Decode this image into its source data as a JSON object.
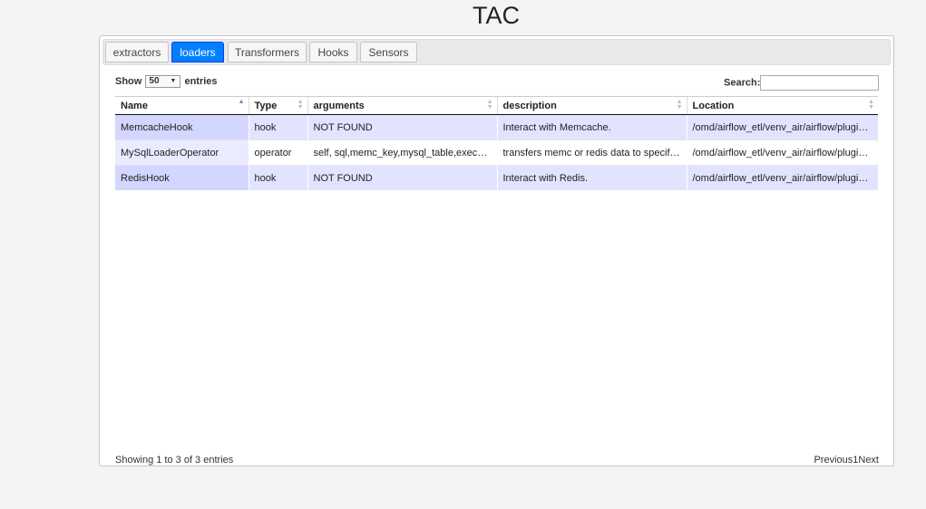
{
  "title": "TAC",
  "tabs": [
    {
      "label": "extractors"
    },
    {
      "label": "loaders"
    },
    {
      "label": "Transformers"
    },
    {
      "label": "Hooks"
    },
    {
      "label": "Sensors"
    }
  ],
  "active_tab": "loaders",
  "length": {
    "show_label": "Show",
    "value": "50",
    "entries_label": "entries"
  },
  "search": {
    "label": "Search:",
    "value": ""
  },
  "columns": [
    "Name",
    "Type",
    "arguments",
    "description",
    "Location"
  ],
  "rows": [
    {
      "name": "MemcacheHook",
      "type": "hook",
      "arguments": "NOT FOUND",
      "description": "Interact with Memcache.",
      "location": "/omd/airflow_etl/venv_air/airflow/plugin…"
    },
    {
      "name": "MySqlLoaderOperator",
      "type": "operator",
      "arguments": "self, sql,memc_key,mysql_table,exec_…",
      "description": "transfers memc or redis data to specif…",
      "location": "/omd/airflow_etl/venv_air/airflow/plugin…"
    },
    {
      "name": "RedisHook",
      "type": "hook",
      "arguments": "NOT FOUND",
      "description": "Interact with Redis.",
      "location": "/omd/airflow_etl/venv_air/airflow/plugin…"
    }
  ],
  "info": "Showing 1 to 3 of 3 entries",
  "paging": {
    "previous": "Previous",
    "page": "1",
    "next": "Next"
  }
}
